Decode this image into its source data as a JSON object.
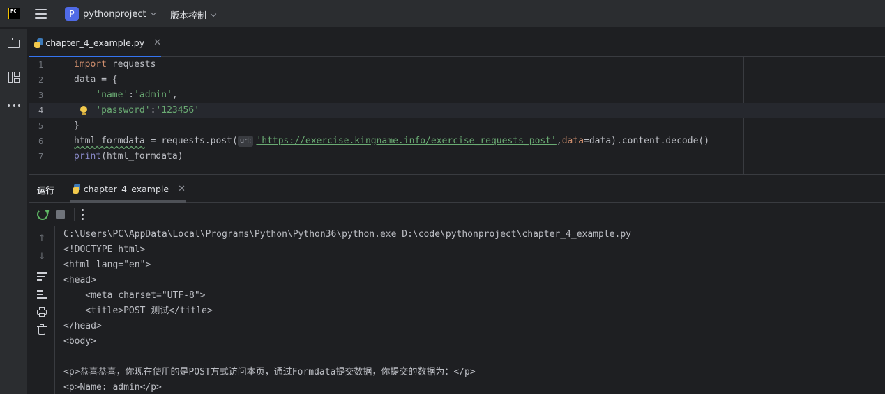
{
  "app": {
    "logo_text": "PC",
    "project_badge": "P",
    "project_name": "pythonproject",
    "vcs_label": "版本控制"
  },
  "colors": {
    "accent": "#3574f0",
    "keyword": "#cf8e6d",
    "string": "#6aab73",
    "builtin": "#8888c6",
    "run_green": "#5fb865"
  },
  "editor": {
    "tab_label": "chapter_4_example.py",
    "lines": [
      {
        "no": "1",
        "kw": "import",
        "rest": " requests"
      },
      {
        "no": "2",
        "text": "data = {"
      },
      {
        "no": "3",
        "indent": "    ",
        "s1": "'name'",
        "mid": ":",
        "s2": "'admin'",
        "tail": ","
      },
      {
        "no": "4",
        "indent": "    ",
        "s1": "'password'",
        "mid": ":",
        "s2": "'123456'"
      },
      {
        "no": "5",
        "text": "}"
      },
      {
        "no": "6",
        "var": "html_formdata",
        "a": " = requests.post(",
        "hint": "url:",
        "url": "'https://exercise.kingname.info/exercise_requests_post'",
        "b": ",",
        "param": "data",
        "c": "=data).content.decode()"
      },
      {
        "no": "7",
        "fn": "print",
        "rest": "(html_formdata)"
      }
    ]
  },
  "run": {
    "title": "运行",
    "tab_label": "chapter_4_example",
    "output": [
      "C:\\Users\\PC\\AppData\\Local\\Programs\\Python\\Python36\\python.exe D:\\code\\pythonproject\\chapter_4_example.py",
      "<!DOCTYPE html>",
      "<html lang=\"en\">",
      "<head>",
      "    <meta charset=\"UTF-8\">",
      "    <title>POST 测试</title>",
      "</head>",
      "<body>",
      "",
      "<p>恭喜恭喜，你现在使用的是POST方式访问本页，通过Formdata提交数据，你提交的数据为：</p>",
      "<p>Name: admin</p>"
    ]
  }
}
